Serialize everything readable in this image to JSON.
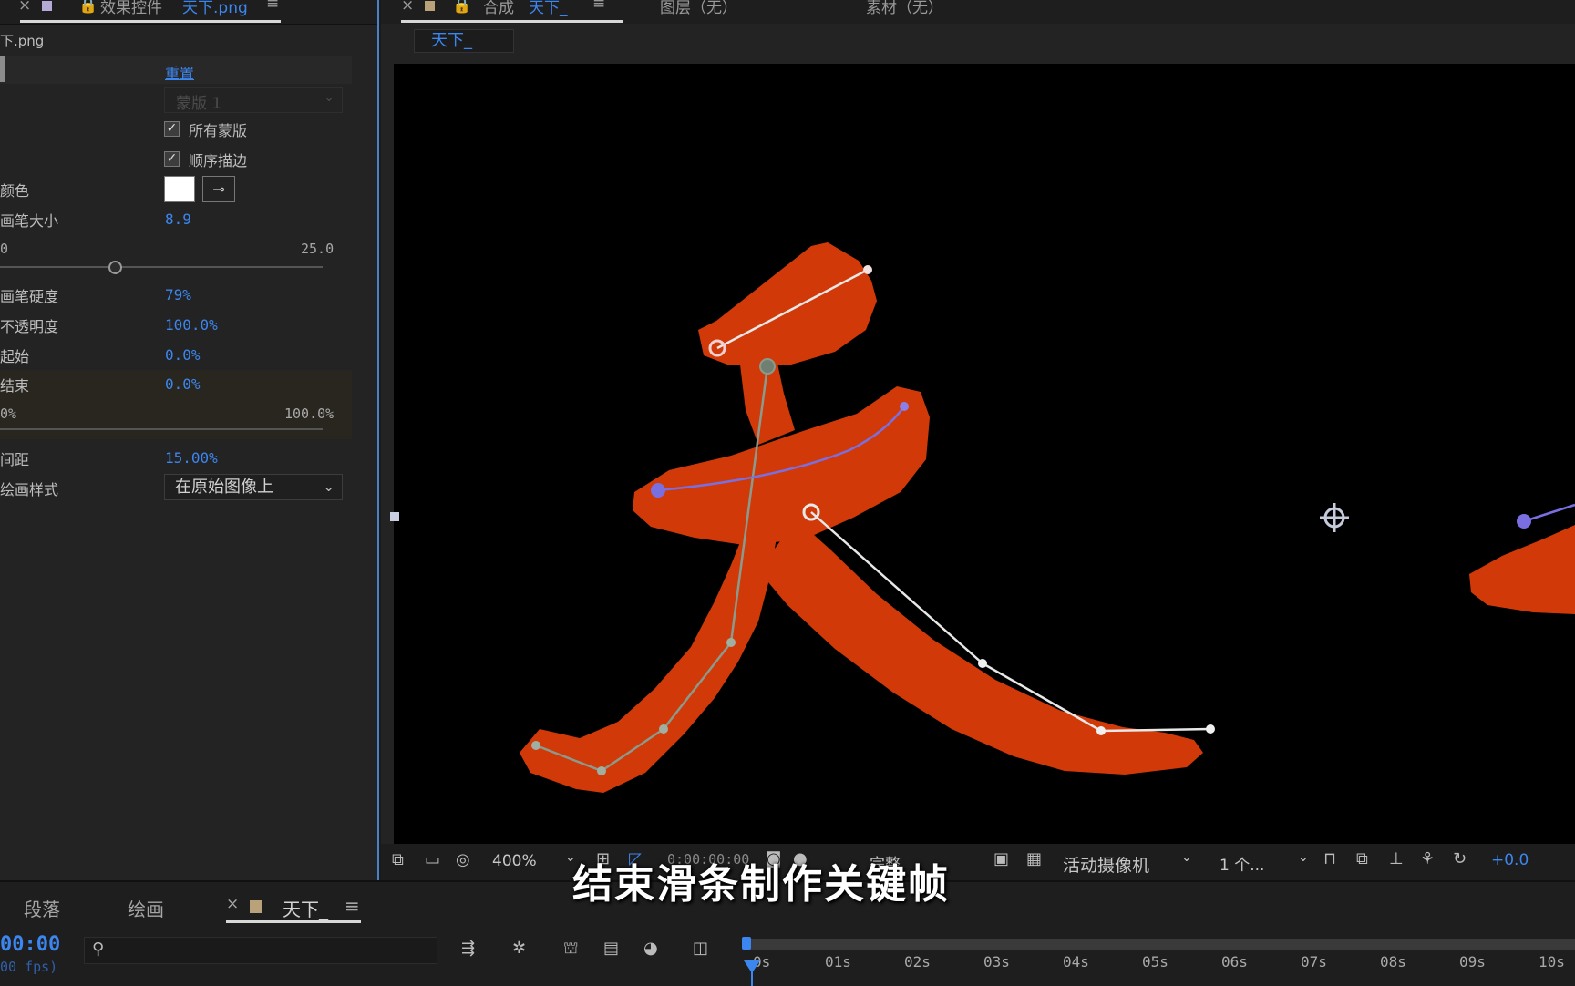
{
  "effects_panel": {
    "tab_title": "效果控件",
    "tab_file": "天下.png",
    "layer_path": "下.png",
    "reset_label": "重置",
    "mask_select": "蒙版 1",
    "all_masks_label": "所有蒙版",
    "all_masks_checked": true,
    "sequential_label": "顺序描边",
    "sequential_checked": true,
    "color_label": "颜色",
    "color_value": "#ffffff",
    "brush_size_label": "画笔大小",
    "brush_size_value": "8.9",
    "brush_size_min": "0",
    "brush_size_max": "25.0",
    "brush_size_fraction": 0.356,
    "hardness_label": "画笔硬度",
    "hardness_value": "79%",
    "opacity_label": "不透明度",
    "opacity_value": "100.0%",
    "start_label": "起始",
    "start_value": "0.0%",
    "end_label": "结束",
    "end_value": "0.0%",
    "end_min": "0%",
    "end_max": "100.0%",
    "end_fraction": 0.0,
    "spacing_label": "间距",
    "spacing_value": "15.00%",
    "paint_style_label": "绘画样式",
    "paint_style_value": "在原始图像上"
  },
  "comp_panel": {
    "tab_title": "合成",
    "tab_comp": "天下_",
    "layer_tab": "图层（无）",
    "footage_tab": "素材（无）",
    "comp_name": "天下_",
    "zoom": "400%",
    "timecode": "0:00:00:00",
    "resolution": "完整",
    "camera": "活动摄像机",
    "views": "1 个...",
    "exposure": "+0.0"
  },
  "timeline": {
    "tab_paragraph": "段落",
    "tab_paint": "绘画",
    "tab_comp": "天下_",
    "current_time": "00:00",
    "fps": "00 fps)",
    "ruler_labels": [
      "0s",
      "01s",
      "02s",
      "03s",
      "04s",
      "05s",
      "06s",
      "07s",
      "08s",
      "09s",
      "10s"
    ]
  },
  "subtitle": "结束滑条制作关键帧",
  "colors": {
    "accent": "#3c86f0",
    "glyph_fill": "#d13a08",
    "path_gray": "#8a9a8c",
    "path_white": "#e8e8e8",
    "path_blue": "#7a6fe0"
  }
}
